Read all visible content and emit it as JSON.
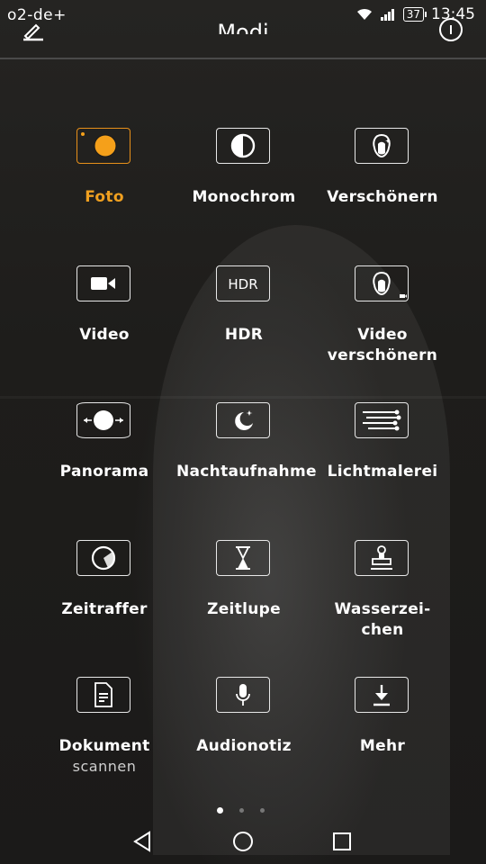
{
  "status_bar": {
    "carrier": "o2-de+",
    "battery": "37",
    "time": "13:45"
  },
  "header": {
    "title": "Modi"
  },
  "modes": [
    {
      "label": "Foto",
      "sublabel": "",
      "icon": "camera-photo-icon",
      "active": true
    },
    {
      "label": "Monochrom",
      "sublabel": "",
      "icon": "monochrome-icon",
      "active": false
    },
    {
      "label": "Verschönern",
      "sublabel": "",
      "icon": "beauty-face-icon",
      "active": false
    },
    {
      "label": "Video",
      "sublabel": "",
      "icon": "video-camera-icon",
      "active": false
    },
    {
      "label": "HDR",
      "sublabel": "",
      "icon": "hdr-icon",
      "active": false
    },
    {
      "label": "Video verschönern",
      "sublabel": "",
      "icon": "video-beauty-icon",
      "active": false
    },
    {
      "label": "Panorama",
      "sublabel": "",
      "icon": "panorama-icon",
      "active": false
    },
    {
      "label": "Nachtaufnahme",
      "sublabel": "",
      "icon": "night-moon-icon",
      "active": false
    },
    {
      "label": "Lichtmalerei",
      "sublabel": "",
      "icon": "light-painting-icon",
      "active": false
    },
    {
      "label": "Zeitraffer",
      "sublabel": "",
      "icon": "time-lapse-icon",
      "active": false
    },
    {
      "label": "Zeitlupe",
      "sublabel": "",
      "icon": "hourglass-icon",
      "active": false
    },
    {
      "label": "Wasserzei-chen",
      "sublabel": "",
      "icon": "watermark-stamp-icon",
      "active": false
    },
    {
      "label": "Dokument",
      "sublabel": "scannen",
      "icon": "document-scan-icon",
      "active": false
    },
    {
      "label": "Audionotiz",
      "sublabel": "",
      "icon": "microphone-icon",
      "active": false
    },
    {
      "label": "Mehr",
      "sublabel": "",
      "icon": "download-icon",
      "active": false
    }
  ],
  "pager": {
    "pages": 3,
    "current": 1
  },
  "nav": {
    "back": "back-icon",
    "home": "home-icon",
    "recents": "recents-icon"
  },
  "colors": {
    "accent": "#f0a020",
    "background": "#1b1a19"
  }
}
